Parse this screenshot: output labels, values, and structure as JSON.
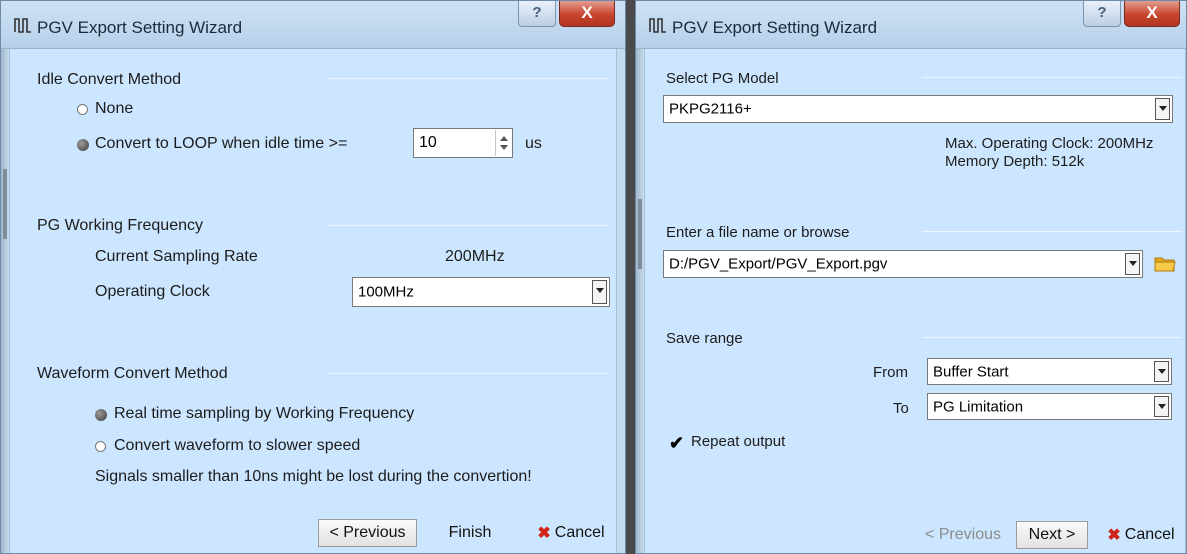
{
  "left": {
    "title": "PGV Export Setting Wizard",
    "help_label": "?",
    "close_label": "X",
    "idle": {
      "heading": "Idle Convert Method",
      "option_none": "None",
      "option_loop": "Convert to LOOP when idle time >=",
      "idle_value": "10",
      "unit": "us",
      "selected": "loop"
    },
    "pg": {
      "heading": "PG Working Frequency",
      "sampling_label": "Current Sampling Rate",
      "sampling_value": "200MHz",
      "clock_label": "Operating Clock",
      "clock_value": "100MHz"
    },
    "waveform": {
      "heading": "Waveform Convert Method",
      "option_realtime": "Real time sampling by Working Frequency",
      "option_slower": "Convert waveform to slower speed",
      "selected": "realtime",
      "warning": "Signals smaller than 10ns might be lost during the convertion!"
    },
    "buttons": {
      "previous": "< Previous",
      "finish": "Finish",
      "cancel": "Cancel"
    }
  },
  "right": {
    "title": "PGV Export Setting Wizard",
    "help_label": "?",
    "close_label": "X",
    "model": {
      "heading": "Select PG Model",
      "value": "PKPG2116+",
      "max_clock": "Max. Operating Clock: 200MHz",
      "memory_depth": "Memory Depth: 512k"
    },
    "file": {
      "heading": "Enter a file name or browse",
      "value": "D:/PGV_Export/PGV_Export.pgv"
    },
    "range": {
      "heading": "Save range",
      "from_label": "From",
      "from_value": "Buffer Start",
      "to_label": "To",
      "to_value": "PG Limitation",
      "repeat_label": "Repeat output",
      "repeat_checked": true
    },
    "buttons": {
      "previous": "< Previous",
      "next": "Next >",
      "cancel": "Cancel"
    }
  },
  "colors": {
    "content_bg": "#cde6ff",
    "close_red": "#c8452f",
    "cancel_x": "#d0241b"
  },
  "icons": [
    "pg-logo-icon",
    "help-icon",
    "close-icon",
    "radio-icon",
    "spinner-icon",
    "dropdown-arrow-icon",
    "cancel-x-icon",
    "folder-icon",
    "checkmark-icon"
  ]
}
